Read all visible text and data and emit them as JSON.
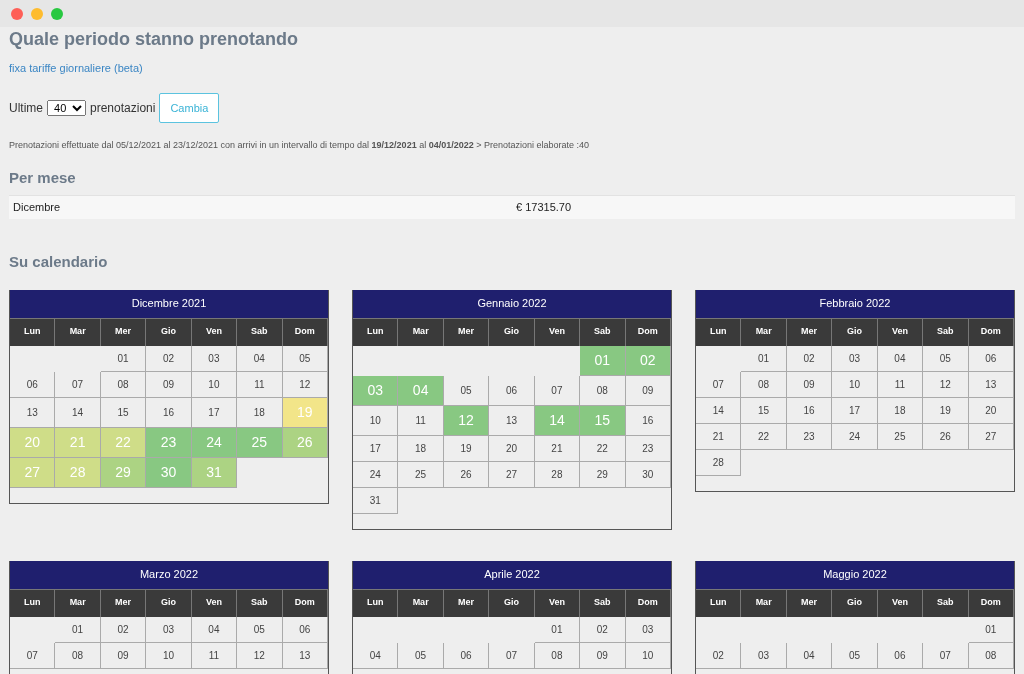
{
  "title": "Quale periodo stanno prenotando",
  "link": "fixa tariffe giornaliere (beta)",
  "filter": {
    "prefix": "Ultime",
    "value": "40",
    "suffix": "prenotazioni",
    "button": "Cambia"
  },
  "info": "Prenotazioni effettuate dal 05/12/2021 al 23/12/2021 con arrivi in un intervallo di tempo dal **19/12/2021** al **04/01/2022** > Prenotazioni elaborate :40",
  "per_month": {
    "heading": "Per mese",
    "rows": [
      {
        "month": "Dicembre",
        "amount": "€ 17315.70"
      }
    ]
  },
  "calendar_heading": "Su calendario",
  "calendars": [
    {
      "title": "Dicembre 2021",
      "weekdays": [
        "Lun",
        "Mar",
        "Mer",
        "Gio",
        "Ven",
        "Sab",
        "Dom"
      ],
      "weeks": [
        {
          "days": [
            {
              "day": "01"
            },
            {
              "day": "02"
            },
            {
              "day": "03"
            },
            {
              "day": "04"
            },
            {
              "day": "05"
            }
          ]
        },
        {
          "days": [
            {
              "day": "06"
            },
            {
              "day": "07"
            },
            {
              "day": "08"
            },
            {
              "day": "09"
            },
            {
              "day": "10"
            },
            {
              "day": "11"
            },
            {
              "day": "12"
            }
          ]
        },
        {
          "days": [
            {
              "day": "13"
            },
            {
              "day": "14"
            },
            {
              "day": "15"
            },
            {
              "day": "16"
            },
            {
              "day": "17"
            },
            {
              "day": "18"
            },
            {
              "day": "19",
              "color": "#f2e589"
            }
          ]
        },
        {
          "days": [
            {
              "day": "20",
              "color": "#cfdd88"
            },
            {
              "day": "21",
              "color": "#cfdd88"
            },
            {
              "day": "22",
              "color": "#cfdd88"
            },
            {
              "day": "23",
              "color": "#88c882"
            },
            {
              "day": "24",
              "color": "#88c882"
            },
            {
              "day": "25",
              "color": "#88c882"
            },
            {
              "day": "26",
              "color": "#acd383"
            }
          ]
        },
        {
          "days": [
            {
              "day": "27",
              "color": "#cfdd88"
            },
            {
              "day": "28",
              "color": "#cfdd88"
            },
            {
              "day": "29",
              "color": "#acd383"
            },
            {
              "day": "30",
              "color": "#88c882"
            },
            {
              "day": "31",
              "color": "#acd383"
            }
          ]
        }
      ]
    },
    {
      "title": "Gennaio 2022",
      "weekdays": [
        "Lun",
        "Mar",
        "Mer",
        "Gio",
        "Ven",
        "Sab",
        "Dom"
      ],
      "weeks": [
        {
          "days": [
            {
              "day": "01",
              "color": "#88c882"
            },
            {
              "day": "02",
              "color": "#88c882"
            }
          ]
        },
        {
          "days": [
            {
              "day": "03",
              "color": "#88c882"
            },
            {
              "day": "04",
              "color": "#88c882"
            },
            {
              "day": "05"
            },
            {
              "day": "06"
            },
            {
              "day": "07"
            },
            {
              "day": "08"
            },
            {
              "day": "09"
            }
          ]
        },
        {
          "days": [
            {
              "day": "10"
            },
            {
              "day": "11"
            },
            {
              "day": "12",
              "color": "#88c882"
            },
            {
              "day": "13"
            },
            {
              "day": "14",
              "color": "#88c882"
            },
            {
              "day": "15",
              "color": "#88c882"
            },
            {
              "day": "16"
            }
          ]
        },
        {
          "days": [
            {
              "day": "17"
            },
            {
              "day": "18"
            },
            {
              "day": "19"
            },
            {
              "day": "20"
            },
            {
              "day": "21"
            },
            {
              "day": "22"
            },
            {
              "day": "23"
            }
          ]
        },
        {
          "days": [
            {
              "day": "24"
            },
            {
              "day": "25"
            },
            {
              "day": "26"
            },
            {
              "day": "27"
            },
            {
              "day": "28"
            },
            {
              "day": "29"
            },
            {
              "day": "30"
            }
          ]
        },
        {
          "days": [
            {
              "day": "31"
            }
          ]
        }
      ]
    },
    {
      "title": "Febbraio 2022",
      "weekdays": [
        "Lun",
        "Mar",
        "Mer",
        "Gio",
        "Ven",
        "Sab",
        "Dom"
      ],
      "weeks": [
        {
          "days": [
            {
              "day": "01"
            },
            {
              "day": "02"
            },
            {
              "day": "03"
            },
            {
              "day": "04"
            },
            {
              "day": "05"
            },
            {
              "day": "06"
            }
          ]
        },
        {
          "days": [
            {
              "day": "07"
            },
            {
              "day": "08"
            },
            {
              "day": "09"
            },
            {
              "day": "10"
            },
            {
              "day": "11"
            },
            {
              "day": "12"
            },
            {
              "day": "13"
            }
          ]
        },
        {
          "days": [
            {
              "day": "14"
            },
            {
              "day": "15"
            },
            {
              "day": "16"
            },
            {
              "day": "17"
            },
            {
              "day": "18"
            },
            {
              "day": "19"
            },
            {
              "day": "20"
            }
          ]
        },
        {
          "days": [
            {
              "day": "21"
            },
            {
              "day": "22"
            },
            {
              "day": "23"
            },
            {
              "day": "24"
            },
            {
              "day": "25"
            },
            {
              "day": "26"
            },
            {
              "day": "27"
            }
          ]
        },
        {
          "days": [
            {
              "day": "28"
            }
          ]
        }
      ]
    },
    {
      "title": "Marzo 2022",
      "weekdays": [
        "Lun",
        "Mar",
        "Mer",
        "Gio",
        "Ven",
        "Sab",
        "Dom"
      ],
      "weeks": [
        {
          "days": [
            {
              "day": "01"
            },
            {
              "day": "02"
            },
            {
              "day": "03"
            },
            {
              "day": "04"
            },
            {
              "day": "05"
            },
            {
              "day": "06"
            }
          ]
        },
        {
          "days": [
            {
              "day": "07"
            },
            {
              "day": "08"
            },
            {
              "day": "09"
            },
            {
              "day": "10"
            },
            {
              "day": "11"
            },
            {
              "day": "12"
            },
            {
              "day": "13"
            }
          ]
        }
      ]
    },
    {
      "title": "Aprile 2022",
      "weekdays": [
        "Lun",
        "Mar",
        "Mer",
        "Gio",
        "Ven",
        "Sab",
        "Dom"
      ],
      "weeks": [
        {
          "days": [
            {
              "day": "01"
            },
            {
              "day": "02"
            },
            {
              "day": "03"
            }
          ]
        },
        {
          "days": [
            {
              "day": "04"
            },
            {
              "day": "05"
            },
            {
              "day": "06"
            },
            {
              "day": "07"
            },
            {
              "day": "08"
            },
            {
              "day": "09"
            },
            {
              "day": "10"
            }
          ]
        }
      ]
    },
    {
      "title": "Maggio 2022",
      "weekdays": [
        "Lun",
        "Mar",
        "Mer",
        "Gio",
        "Ven",
        "Sab",
        "Dom"
      ],
      "weeks": [
        {
          "days": [
            {
              "day": "01"
            }
          ]
        },
        {
          "days": [
            {
              "day": "02"
            },
            {
              "day": "03"
            },
            {
              "day": "04"
            },
            {
              "day": "05"
            },
            {
              "day": "06"
            },
            {
              "day": "07"
            },
            {
              "day": "08"
            }
          ]
        }
      ]
    }
  ]
}
